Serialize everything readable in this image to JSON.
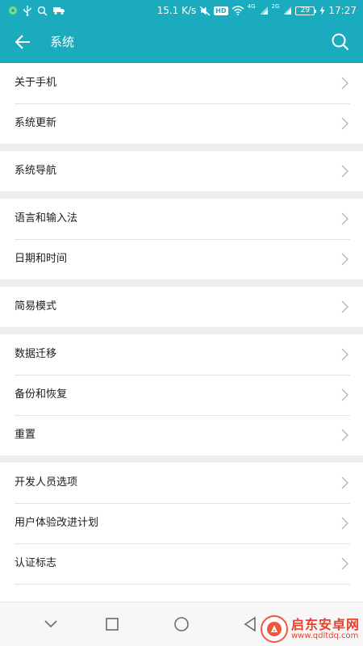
{
  "status_bar": {
    "speed": "15.1 K/s",
    "hd_badge": "HD",
    "net_4g": "4G",
    "net_2g": "2G",
    "battery": "29",
    "time": "17:27",
    "icons": [
      "app-notification-icon",
      "usb-icon",
      "search-icon",
      "truck-icon",
      "mute-icon",
      "wifi-icon",
      "signal-icon",
      "charging-icon"
    ]
  },
  "header": {
    "title": "系统",
    "back_icon": "arrow-left-icon",
    "search_icon": "search-icon"
  },
  "groups": [
    {
      "items": [
        {
          "label": "关于手机"
        },
        {
          "label": "系统更新"
        }
      ]
    },
    {
      "items": [
        {
          "label": "系统导航"
        }
      ]
    },
    {
      "items": [
        {
          "label": "语言和输入法"
        },
        {
          "label": "日期和时间"
        }
      ]
    },
    {
      "items": [
        {
          "label": "简易模式"
        }
      ]
    },
    {
      "items": [
        {
          "label": "数据迁移"
        },
        {
          "label": "备份和恢复"
        },
        {
          "label": "重置"
        }
      ]
    },
    {
      "items": [
        {
          "label": "开发人员选项"
        },
        {
          "label": "用户体验改进计划"
        },
        {
          "label": "认证标志"
        }
      ]
    }
  ],
  "nav_bar": {
    "buttons": [
      "chevron-down-icon",
      "square-icon",
      "circle-icon",
      "triangle-back-icon"
    ]
  },
  "watermark": {
    "main": "启东安卓网",
    "sub": "www.qdltdq.com"
  },
  "colors": {
    "accent": "#1aacbe",
    "background": "#ededed",
    "text": "#1c1c1c",
    "chevron": "#b5b5b5",
    "watermark": "#e8402d"
  }
}
